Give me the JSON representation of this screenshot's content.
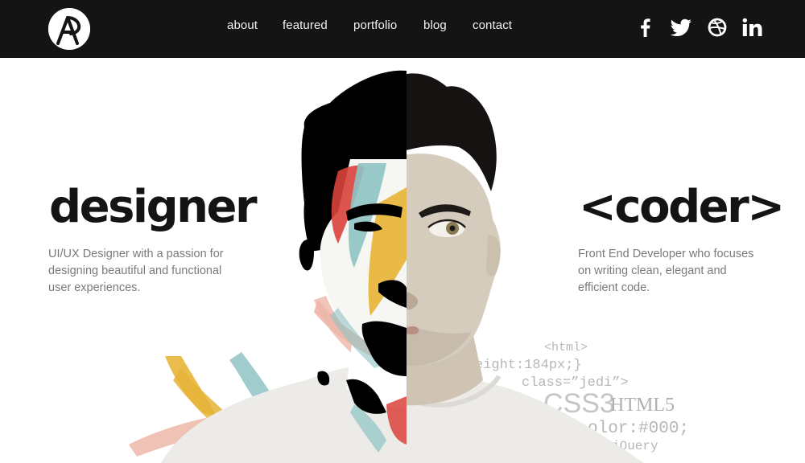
{
  "brand": {
    "logo_letters": "AP",
    "logo_icon": "ap-monogram-logo-icon"
  },
  "nav": {
    "links": [
      {
        "label": "about"
      },
      {
        "label": "featured"
      },
      {
        "label": "portfolio"
      },
      {
        "label": "blog"
      },
      {
        "label": "contact"
      }
    ]
  },
  "social": [
    {
      "name": "facebook",
      "icon": "facebook-icon"
    },
    {
      "name": "twitter",
      "icon": "twitter-icon"
    },
    {
      "name": "dribbble",
      "icon": "dribbble-icon"
    },
    {
      "name": "linkedin",
      "icon": "linkedin-icon"
    }
  ],
  "hero": {
    "left": {
      "title": "designer",
      "description_lines": [
        "UI/UX Designer with a passion for",
        "designing beautiful and functional",
        "user experiences."
      ]
    },
    "right": {
      "title": "<coder>",
      "description_lines": [
        "Front End Developer who focuses",
        "on writing clean, elegant and",
        "efficient code."
      ]
    },
    "code_snippets": [
      "<html>",
      "eight:184px;}",
      "class=”jedi”>",
      "CSS3",
      "HTML5",
      "olor:#000;",
      "jQuery"
    ]
  },
  "colors": {
    "navbar_bg": "#141414",
    "nav_text": "#f2f2f2",
    "headline": "#141414",
    "body_text": "#7a7a7a",
    "code_text": "#b7b7b7",
    "paint_teal": "#8fc3c4",
    "paint_yellow": "#e8b43a",
    "paint_red": "#d9433b",
    "paint_pink": "#edb6a8"
  }
}
